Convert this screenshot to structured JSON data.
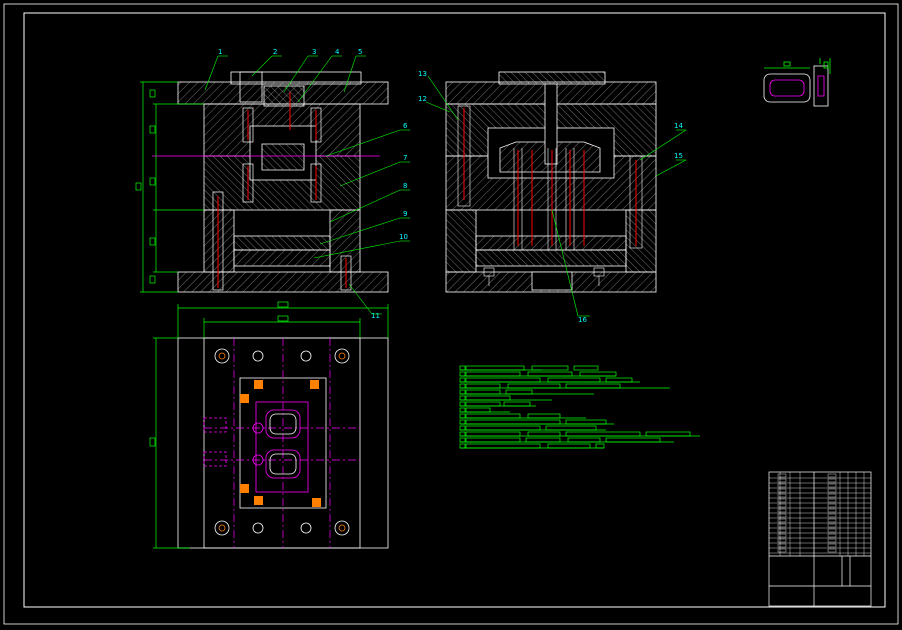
{
  "drawing": {
    "part_labels": [
      "1",
      "2",
      "3",
      "4",
      "5",
      "6",
      "7",
      "8",
      "9",
      "10",
      "11",
      "12",
      "13",
      "14",
      "15",
      "16"
    ]
  },
  "colors": {
    "background": "#000000",
    "outline": "#ffffff",
    "dimension": "#00ff00",
    "leader": "#00ff00",
    "label": "#00ffff",
    "pin": "#ff0000",
    "centerline": "#ff00ff",
    "cooling": "#ff8000",
    "part_outline": "#ff00ff"
  }
}
